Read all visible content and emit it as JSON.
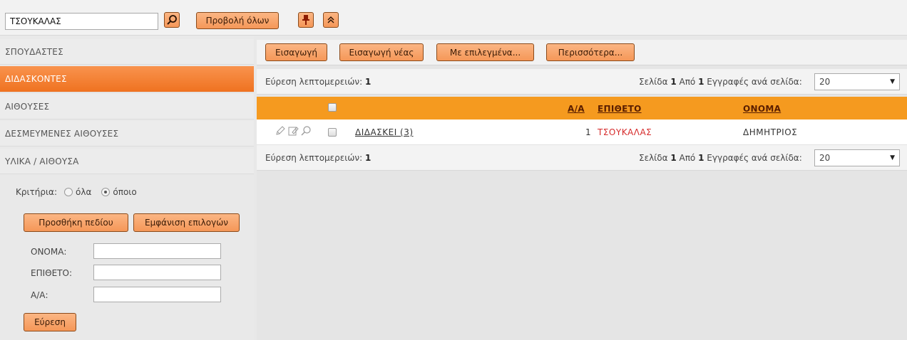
{
  "top": {
    "search_value": "ΤΣΟΥΚΑΛΑΣ",
    "show_all": "Προβολή όλων"
  },
  "sidebar": {
    "items": [
      {
        "label": "ΣΠΟΥΔΑΣΤΕΣ",
        "active": false
      },
      {
        "label": "ΔΙΔΑΣΚΟΝΤΕΣ",
        "active": true
      },
      {
        "label": "ΑΙΘΟΥΣΕΣ",
        "active": false
      },
      {
        "label": "ΔΕΣΜΕΥΜΕΝΕΣ ΑΙΘΟΥΣΕΣ",
        "active": false
      },
      {
        "label": "ΥΛΙΚΑ / ΑΙΘΟΥΣΑ",
        "active": false
      }
    ],
    "criteria_label": "Κριτήρια:",
    "criteria_all": "όλα",
    "criteria_any": "όποιο",
    "add_field": "Προσθήκη πεδίου",
    "show_options": "Εμφάνιση επιλογών",
    "fields": [
      {
        "label": "ΟΝΟΜΑ:",
        "value": ""
      },
      {
        "label": "ΕΠΙΘΕΤΟ:",
        "value": ""
      },
      {
        "label": "Α/Α:",
        "value": ""
      }
    ],
    "find": "Εύρεση"
  },
  "toolbar": {
    "insert": "Εισαγωγή",
    "insert_new": "Εισαγωγή νέας",
    "with_selected": "Με επιλεγμένα...",
    "more": "Περισσότερα..."
  },
  "pager": {
    "found_label": "Εύρεση λεπτομερειών:",
    "found_count": "1",
    "page_label": "Σελίδα",
    "page": "1",
    "of_label": "Από",
    "total_pages": "1",
    "per_page_label": "Εγγραφές ανά σελίδα:",
    "per_page": "20"
  },
  "table": {
    "headers": {
      "aa": "Α/Α",
      "surname": "ΕΠΙΘΕΤΟ",
      "name": "ΟΝΟΜΑ"
    },
    "rows": [
      {
        "link": "ΔΙΔΑΣΚΕΙ (3)",
        "aa": "1",
        "surname": "ΤΣΟΥΚΑΛΑΣ",
        "name": "ΔΗΜΗΤΡΙΟΣ"
      }
    ]
  },
  "colors": {
    "accent": "#f59a1f",
    "active_nav": "#ef7220",
    "button": "#f59758",
    "surname_text": "#d62b2b"
  }
}
